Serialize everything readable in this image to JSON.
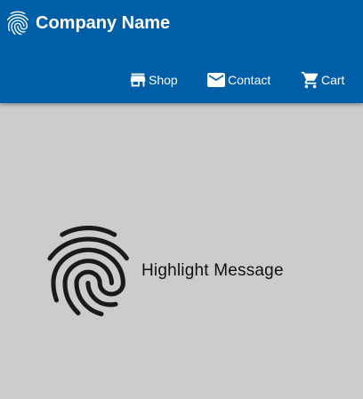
{
  "header": {
    "brand_name": "Company Name",
    "brand_icon": "fingerprint-icon",
    "background": "#005ea7"
  },
  "nav": {
    "items": [
      {
        "label": "Shop",
        "icon": "store-icon"
      },
      {
        "label": "Contact",
        "icon": "mail-icon"
      },
      {
        "label": "Cart",
        "icon": "cart-icon"
      }
    ]
  },
  "main": {
    "background": "#cccccc",
    "highlight": {
      "text": "Highlight Message",
      "icon": "fingerprint-icon"
    }
  }
}
